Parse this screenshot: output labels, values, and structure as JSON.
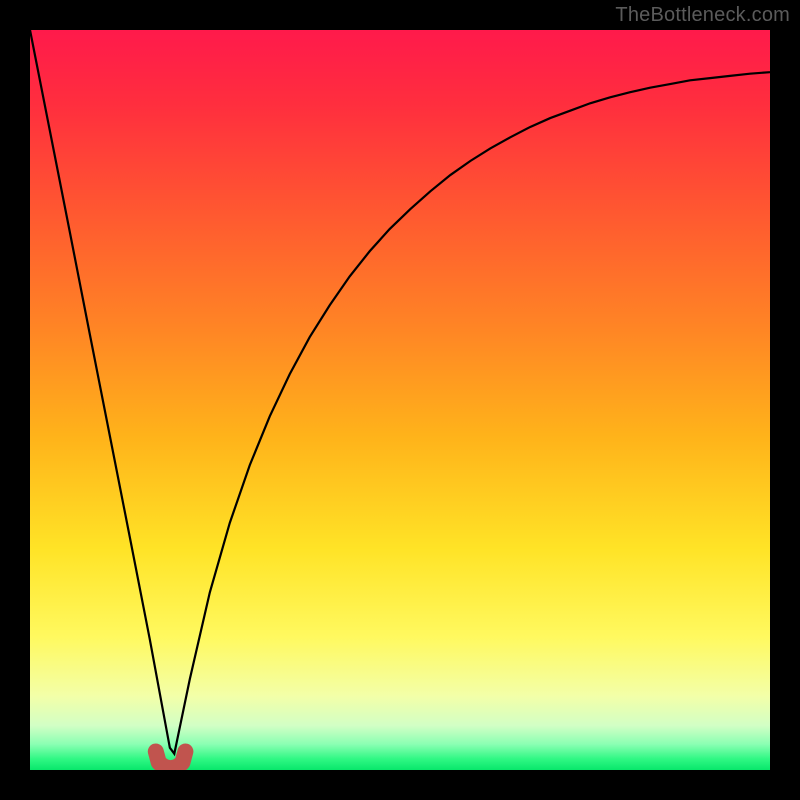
{
  "attribution": "TheBottleneck.com",
  "gradient": {
    "stops": [
      {
        "offset": 0.0,
        "color": "#ff1a4b"
      },
      {
        "offset": 0.1,
        "color": "#ff2e3e"
      },
      {
        "offset": 0.25,
        "color": "#ff5930"
      },
      {
        "offset": 0.4,
        "color": "#ff8425"
      },
      {
        "offset": 0.55,
        "color": "#ffb31a"
      },
      {
        "offset": 0.7,
        "color": "#ffe326"
      },
      {
        "offset": 0.82,
        "color": "#fff95f"
      },
      {
        "offset": 0.9,
        "color": "#f3ffa8"
      },
      {
        "offset": 0.94,
        "color": "#d2ffc5"
      },
      {
        "offset": 0.965,
        "color": "#8bffb3"
      },
      {
        "offset": 0.985,
        "color": "#30f884"
      },
      {
        "offset": 1.0,
        "color": "#08e76b"
      }
    ]
  },
  "marker": {
    "color": "#c1544e",
    "stroke_width": 16,
    "linecap": "round"
  },
  "curve": {
    "stroke": "#000000",
    "stroke_width": 2.2
  },
  "chart_data": {
    "type": "line",
    "title": "",
    "xlabel": "",
    "ylabel": "",
    "xlim": [
      0,
      100
    ],
    "ylim": [
      0,
      100
    ],
    "x_highlight_range": [
      17,
      21
    ],
    "series": [
      {
        "name": "bottleneck-curve",
        "x": [
          0,
          2.7,
          5.4,
          8.1,
          10.8,
          13.5,
          16.2,
          18.9,
          19.5,
          21.6,
          24.3,
          27.0,
          29.7,
          32.4,
          35.1,
          37.8,
          40.5,
          43.2,
          45.9,
          48.6,
          51.4,
          54.1,
          56.8,
          59.5,
          62.2,
          64.9,
          67.6,
          70.3,
          73.0,
          75.7,
          78.4,
          81.1,
          83.8,
          86.5,
          89.2,
          91.9,
          94.6,
          97.3,
          100.0
        ],
        "y": [
          100,
          86.3,
          72.6,
          58.8,
          45.1,
          31.4,
          17.6,
          3,
          2.2,
          12.3,
          24.0,
          33.4,
          41.2,
          47.8,
          53.5,
          58.5,
          62.8,
          66.7,
          70.1,
          73.1,
          75.8,
          78.2,
          80.4,
          82.3,
          84.0,
          85.5,
          86.9,
          88.1,
          89.1,
          90.1,
          90.9,
          91.6,
          92.2,
          92.7,
          93.2,
          93.5,
          93.8,
          94.1,
          94.3
        ]
      }
    ]
  }
}
